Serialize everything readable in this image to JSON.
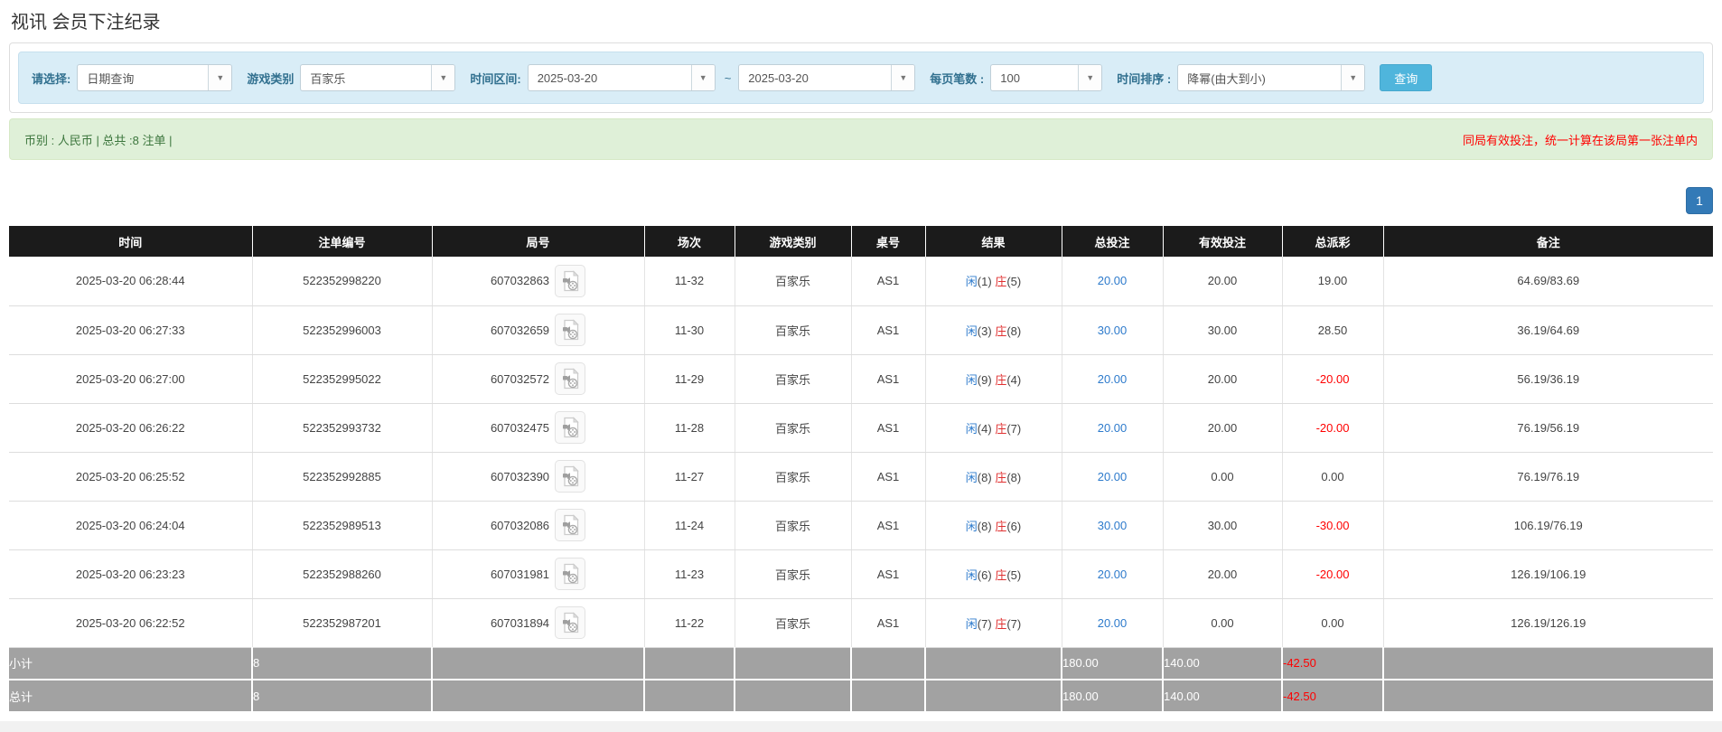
{
  "page": {
    "title": "视讯 会员下注纪录"
  },
  "filters": {
    "select_label": "请选择:",
    "select_value": "日期查询",
    "game_type_label": "游戏类别",
    "game_type_value": "百家乐",
    "time_range_label": "时间区间:",
    "date_from": "2025-03-20",
    "date_separator": "~",
    "date_to": "2025-03-20",
    "page_size_label": "每页笔数 :",
    "page_size_value": "100",
    "sort_label": "时间排序 :",
    "sort_value": "降幂(由大到小)",
    "search_button": "查询",
    "dropdown_arrow": "▼"
  },
  "summary_bar": {
    "left_text": "币别 : 人民币 | 总共 :8 注单 |",
    "right_note": "同局有效投注，统一计算在该局第一张注单内"
  },
  "pagination": {
    "page": "1"
  },
  "colors": {
    "accent_blue": "#2e7bcc",
    "banker_red": "#e03131",
    "negative_red": "#ff0000",
    "header_bg": "#1b1b1b",
    "summary_row_bg": "#a2a2a2",
    "filter_bar_bg": "#d9edf7",
    "summary_bar_bg": "#dff0d8"
  },
  "table": {
    "columns": [
      "时间",
      "注单编号",
      "局号",
      "场次",
      "游戏类别",
      "桌号",
      "结果",
      "总投注",
      "有效投注",
      "总派彩",
      "备注"
    ],
    "rows": [
      {
        "time": "2025-03-20 06:28:44",
        "bet_id": "522352998220",
        "round_id": "607032863",
        "session": "11-32",
        "game_type": "百家乐",
        "table_no": "AS1",
        "result_player_label": "闲",
        "result_player_count": "(1)",
        "result_banker_label": "庄",
        "result_banker_count": "(5)",
        "total_bet": "20.00",
        "valid_bet": "20.00",
        "payout": "19.00",
        "remark": "64.69/83.69"
      },
      {
        "time": "2025-03-20 06:27:33",
        "bet_id": "522352996003",
        "round_id": "607032659",
        "session": "11-30",
        "game_type": "百家乐",
        "table_no": "AS1",
        "result_player_label": "闲",
        "result_player_count": "(3)",
        "result_banker_label": "庄",
        "result_banker_count": "(8)",
        "total_bet": "30.00",
        "valid_bet": "30.00",
        "payout": "28.50",
        "remark": "36.19/64.69"
      },
      {
        "time": "2025-03-20 06:27:00",
        "bet_id": "522352995022",
        "round_id": "607032572",
        "session": "11-29",
        "game_type": "百家乐",
        "table_no": "AS1",
        "result_player_label": "闲",
        "result_player_count": "(9)",
        "result_banker_label": "庄",
        "result_banker_count": "(4)",
        "total_bet": "20.00",
        "valid_bet": "20.00",
        "payout": "-20.00",
        "remark": "56.19/36.19"
      },
      {
        "time": "2025-03-20 06:26:22",
        "bet_id": "522352993732",
        "round_id": "607032475",
        "session": "11-28",
        "game_type": "百家乐",
        "table_no": "AS1",
        "result_player_label": "闲",
        "result_player_count": "(4)",
        "result_banker_label": "庄",
        "result_banker_count": "(7)",
        "total_bet": "20.00",
        "valid_bet": "20.00",
        "payout": "-20.00",
        "remark": "76.19/56.19"
      },
      {
        "time": "2025-03-20 06:25:52",
        "bet_id": "522352992885",
        "round_id": "607032390",
        "session": "11-27",
        "game_type": "百家乐",
        "table_no": "AS1",
        "result_player_label": "闲",
        "result_player_count": "(8)",
        "result_banker_label": "庄",
        "result_banker_count": "(8)",
        "total_bet": "20.00",
        "valid_bet": "0.00",
        "payout": "0.00",
        "remark": "76.19/76.19"
      },
      {
        "time": "2025-03-20 06:24:04",
        "bet_id": "522352989513",
        "round_id": "607032086",
        "session": "11-24",
        "game_type": "百家乐",
        "table_no": "AS1",
        "result_player_label": "闲",
        "result_player_count": "(8)",
        "result_banker_label": "庄",
        "result_banker_count": "(6)",
        "total_bet": "30.00",
        "valid_bet": "30.00",
        "payout": "-30.00",
        "remark": "106.19/76.19"
      },
      {
        "time": "2025-03-20 06:23:23",
        "bet_id": "522352988260",
        "round_id": "607031981",
        "session": "11-23",
        "game_type": "百家乐",
        "table_no": "AS1",
        "result_player_label": "闲",
        "result_player_count": "(6)",
        "result_banker_label": "庄",
        "result_banker_count": "(5)",
        "total_bet": "20.00",
        "valid_bet": "20.00",
        "payout": "-20.00",
        "remark": "126.19/106.19"
      },
      {
        "time": "2025-03-20 06:22:52",
        "bet_id": "522352987201",
        "round_id": "607031894",
        "session": "11-22",
        "game_type": "百家乐",
        "table_no": "AS1",
        "result_player_label": "闲",
        "result_player_count": "(7)",
        "result_banker_label": "庄",
        "result_banker_count": "(7)",
        "total_bet": "20.00",
        "valid_bet": "0.00",
        "payout": "0.00",
        "remark": "126.19/126.19"
      }
    ],
    "subtotal": {
      "label": "小计",
      "count": "8",
      "total_bet": "180.00",
      "valid_bet": "140.00",
      "payout": "-42.50"
    },
    "total": {
      "label": "总计",
      "count": "8",
      "total_bet": "180.00",
      "valid_bet": "140.00",
      "payout": "-42.50"
    }
  }
}
